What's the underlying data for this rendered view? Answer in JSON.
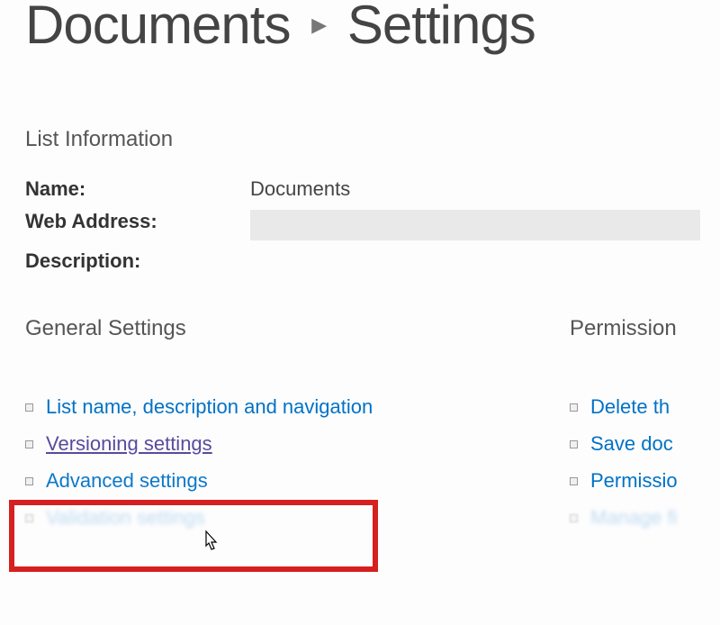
{
  "breadcrumb": {
    "item1": "Documents",
    "item2": "Settings"
  },
  "listInfo": {
    "heading": "List Information",
    "nameLabel": "Name:",
    "nameValue": "Documents",
    "webAddressLabel": "Web Address:",
    "descriptionLabel": "Description:"
  },
  "columns": {
    "generalHeading": "General Settings",
    "permissionsHeading": "Permission"
  },
  "generalLinks": {
    "l1": "List name, description and navigation",
    "l2": "Versioning settings",
    "l3": "Advanced settings",
    "l4": "Validation settings"
  },
  "rightLinks": {
    "r1": "Delete th",
    "r2": "Save doc",
    "r3": "Permissio",
    "r4": "Manage fi"
  }
}
